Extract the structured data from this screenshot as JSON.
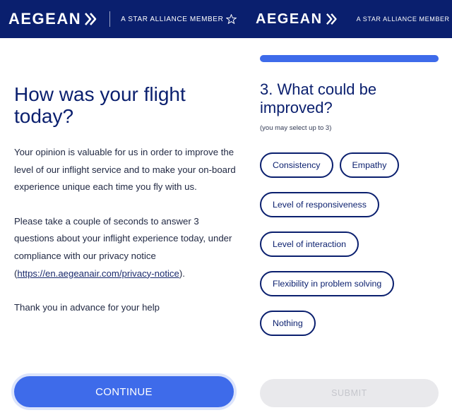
{
  "brand": {
    "name": "AEGEAN",
    "alliance_text": "A STAR ALLIANCE MEMBER",
    "header_color": "#0a1f6e",
    "accent_color": "#3e6bea",
    "logo_icon": "double-chevron-icon",
    "alliance_icon": "star-icon"
  },
  "intro_screen": {
    "title": "How was your flight today?",
    "paragraph1": "Your opinion is valuable for us in order to improve the level of our inflight service and to make your on-board experience unique each time you fly with us.",
    "paragraph2_text": "Please take a couple of seconds to answer 3 questions about your inflight experience today, under compliance with our privacy notice (",
    "privacy_link": "https://en.aegeanair.com/privacy-notice",
    "paragraph2_close": ").",
    "paragraph3": "Thank you in advance for your help",
    "continue_label": "CONTINUE"
  },
  "question_screen": {
    "progress_fraction": 1.0,
    "title": "3. What could be improved?",
    "subtitle": "(you may select up to 3)",
    "options": [
      "Consistency",
      "Empathy",
      "Level of responsiveness",
      "Level of interaction",
      "Flexibility in problem solving",
      "Nothing"
    ],
    "submit_label": "SUBMIT"
  }
}
